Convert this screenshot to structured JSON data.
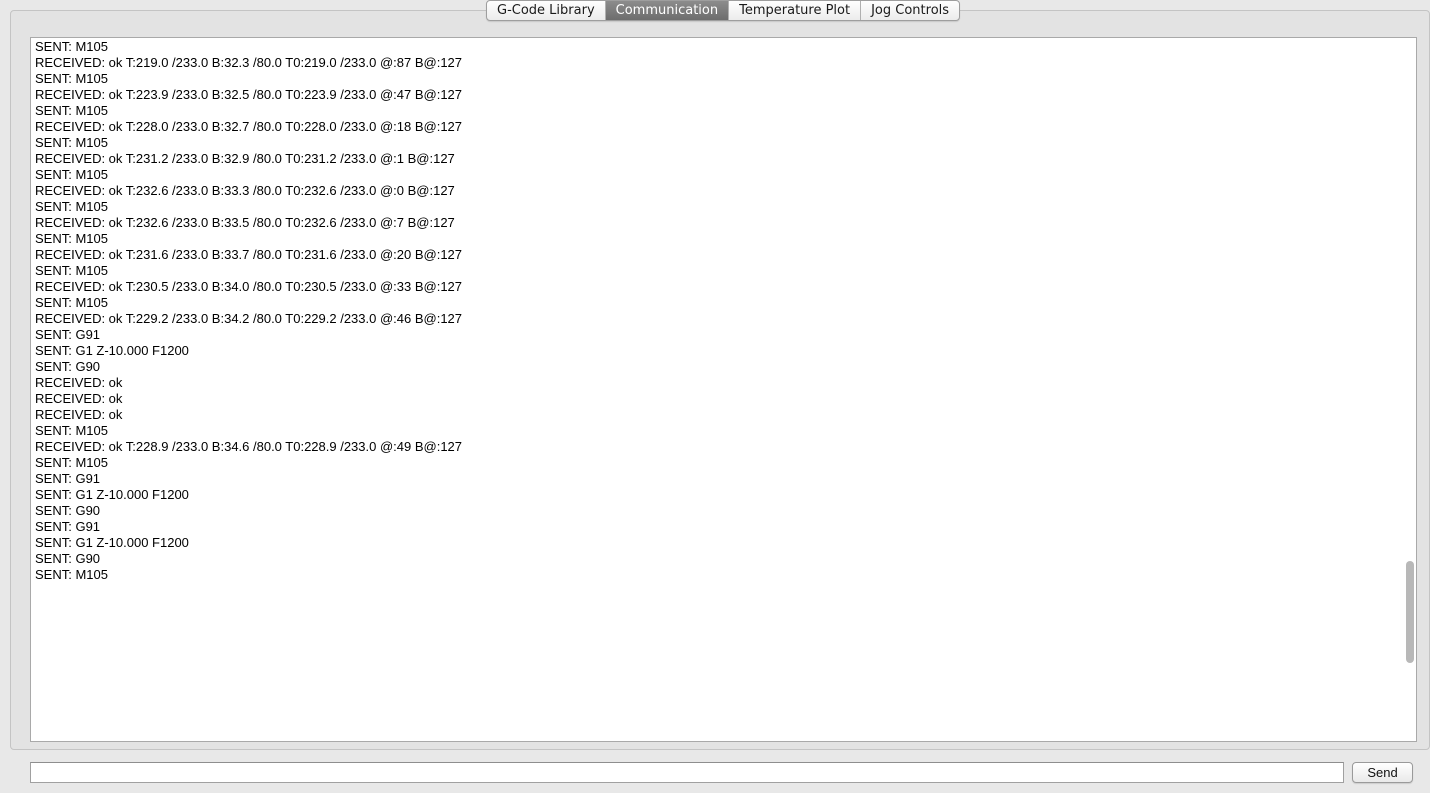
{
  "tabs": [
    {
      "label": "G-Code Library",
      "active": false
    },
    {
      "label": "Communication",
      "active": true
    },
    {
      "label": "Temperature Plot",
      "active": false
    },
    {
      "label": "Jog Controls",
      "active": false
    }
  ],
  "log": {
    "lines": [
      "SENT: M105",
      "RECEIVED: ok T:219.0 /233.0 B:32.3 /80.0 T0:219.0 /233.0 @:87 B@:127",
      "SENT: M105",
      "RECEIVED: ok T:223.9 /233.0 B:32.5 /80.0 T0:223.9 /233.0 @:47 B@:127",
      "SENT: M105",
      "RECEIVED: ok T:228.0 /233.0 B:32.7 /80.0 T0:228.0 /233.0 @:18 B@:127",
      "SENT: M105",
      "RECEIVED: ok T:231.2 /233.0 B:32.9 /80.0 T0:231.2 /233.0 @:1 B@:127",
      "SENT: M105",
      "RECEIVED: ok T:232.6 /233.0 B:33.3 /80.0 T0:232.6 /233.0 @:0 B@:127",
      "SENT: M105",
      "RECEIVED: ok T:232.6 /233.0 B:33.5 /80.0 T0:232.6 /233.0 @:7 B@:127",
      "SENT: M105",
      "RECEIVED: ok T:231.6 /233.0 B:33.7 /80.0 T0:231.6 /233.0 @:20 B@:127",
      "SENT: M105",
      "RECEIVED: ok T:230.5 /233.0 B:34.0 /80.0 T0:230.5 /233.0 @:33 B@:127",
      "SENT: M105",
      "RECEIVED: ok T:229.2 /233.0 B:34.2 /80.0 T0:229.2 /233.0 @:46 B@:127",
      "SENT: G91",
      "SENT: G1 Z-10.000 F1200",
      "SENT: G90",
      "RECEIVED: ok",
      "RECEIVED: ok",
      "RECEIVED: ok",
      "SENT: M105",
      "RECEIVED: ok T:228.9 /233.0 B:34.6 /80.0 T0:228.9 /233.0 @:49 B@:127",
      "SENT: M105",
      "SENT: G91",
      "SENT: G1 Z-10.000 F1200",
      "SENT: G90",
      "SENT: G91",
      "SENT: G1 Z-10.000 F1200",
      "SENT: G90",
      "SENT: M105"
    ]
  },
  "command": {
    "value": "",
    "send_label": "Send"
  }
}
